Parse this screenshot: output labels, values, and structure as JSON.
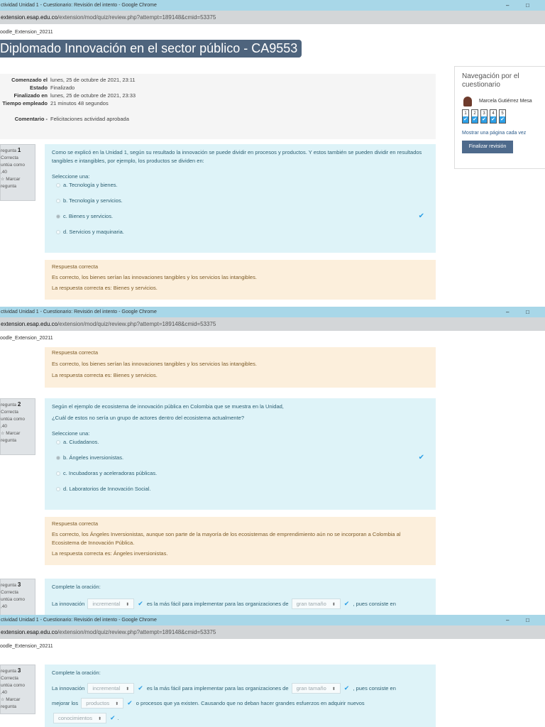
{
  "window": {
    "title": "ctividad Unidad 1 - Cuestionario: Revisión del intento - Google Chrome",
    "url_host": "extension.esap.edu.co",
    "url_path": "/extension/mod/quiz/review.php?attempt=189148&cmid=53375",
    "minimize": "–",
    "maximize": "□"
  },
  "breadcrumb": "oodle_Extension_20211",
  "course_title": "Diplomado Innovación en el sector público - CA9553",
  "summary": [
    {
      "label": "Comenzado el",
      "value": "lunes, 25 de octubre de 2021, 23:11"
    },
    {
      "label": "Estado",
      "value": "Finalizado"
    },
    {
      "label": "Finalizado en",
      "value": "lunes, 25 de octubre de 2021, 23:33"
    },
    {
      "label": "Tiempo empleado",
      "value": "21 minutos 48 segundos"
    },
    {
      "label": "Comentario -",
      "value": "Felicitaciones actividad aprobada"
    }
  ],
  "nav": {
    "title": "Navegación por el cuestionario",
    "user": "Marcela Gutiérrez Mesa",
    "questions": [
      "1",
      "2",
      "3",
      "4",
      "5"
    ],
    "check": "✔",
    "show_one_page": "Mostrar una página cada vez",
    "finish": "Finalizar revisión"
  },
  "q1": {
    "label": "regunta",
    "num": "1",
    "status": "Correcta",
    "score": "untúa como",
    "score2": ",40",
    "flag": "Marcar",
    "flag2": "regunta",
    "text": "Como se explicó en la Unidad 1, según su resultado la innovación se puede dividir en procesos y productos. Y estos también se pueden dividir en resultados tangibles e intangibles, por ejemplo, los productos se dividen en:",
    "prompt": "Seleccione una:",
    "options": [
      "a. Tecnología y bienes.",
      "b. Tecnología y servicios.",
      "c. Bienes y servicios.",
      "d. Servicios y maquinaria."
    ],
    "feedback": [
      "Respuesta correcta",
      "Es correcto, los bienes serían las innovaciones tangibles y los servicios las intangibles.",
      "La respuesta correcta es: Bienes y servicios."
    ]
  },
  "q2": {
    "label": "regunta",
    "num": "2",
    "status": "Correcta",
    "score": "untúa como",
    "score2": ",40",
    "flag": "Marcar",
    "flag2": "regunta",
    "text1": "Según el ejemplo de ecosistema de innovación pública en Colombia que se muestra en la Unidad,",
    "text2": "¿Cuál de estos no sería un grupo de actores dentro del ecosistema actualmente?",
    "prompt": "Seleccione una:",
    "options": [
      "a. Ciudadanos.",
      "b. Ángeles inversionistas.",
      "c. Incubadoras y aceleradoras públicas.",
      "d. Laboratorios de Innovación Social."
    ],
    "feedback": [
      "Respuesta correcta",
      "Es correcto, los Ángeles Inversionistas, aunque son parte de la mayoría de los ecosistemas de emprendimiento aún no se incorporan a Colombia al Ecosistema de Innovación Pública.",
      "La respuesta correcta es: Ángeles inversionistas."
    ]
  },
  "q3": {
    "label": "regunta",
    "num": "3",
    "status": "Correcta",
    "score": "untúa como",
    "score2": ",40",
    "flag": "Marcar",
    "flag2": "regunta",
    "heading": "Complete la oración:",
    "t1": "La innovación",
    "s1": "incremental",
    "t2": "es la más fácil para implementar para las organizaciones de",
    "s2": "gran tamaño",
    "t3": ", pues consiste en",
    "t4": "mejorar los",
    "s3": "productos",
    "t5": "o procesos que ya existen. Causando que no deban hacer grandes esfuerzos en adquirir nuevos",
    "s4": "conocimientos",
    "t6": ".",
    "caret": "⬍",
    "tick": "✔"
  }
}
